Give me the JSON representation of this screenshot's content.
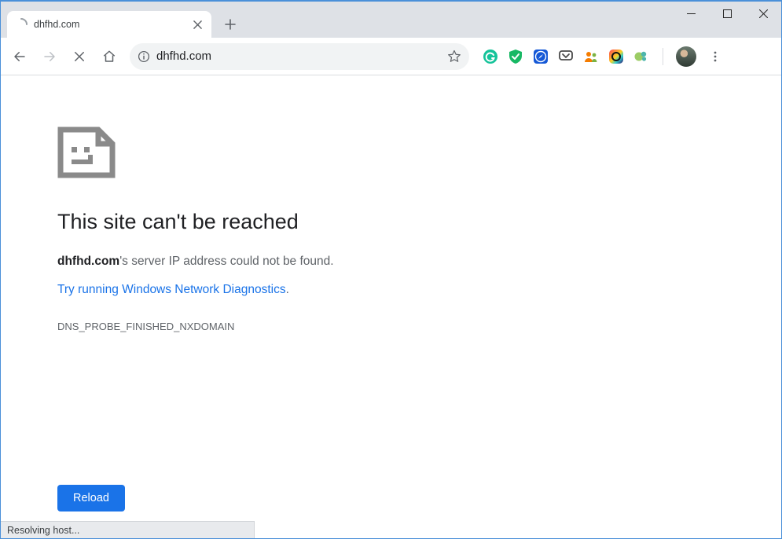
{
  "window": {
    "tab_title": "dhfhd.com",
    "controls": {
      "min": "min",
      "max": "max",
      "close": "close"
    }
  },
  "toolbar": {
    "url": "dhfhd.com"
  },
  "extensions": [
    {
      "name": "grammarly-icon"
    },
    {
      "name": "shield-icon"
    },
    {
      "name": "safari-like-icon"
    },
    {
      "name": "pocket-icon"
    },
    {
      "name": "people-icon"
    },
    {
      "name": "rainbow-circle-icon"
    },
    {
      "name": "puzzle-icon"
    }
  ],
  "error": {
    "heading": "This site can't be reached",
    "domain": "dhfhd.com",
    "message_suffix": "'s server IP address could not be found.",
    "diagnostics_link": "Try running Windows Network Diagnostics",
    "diagnostics_period": ".",
    "code": "DNS_PROBE_FINISHED_NXDOMAIN",
    "reload_label": "Reload"
  },
  "status_bar": "Resolving host..."
}
